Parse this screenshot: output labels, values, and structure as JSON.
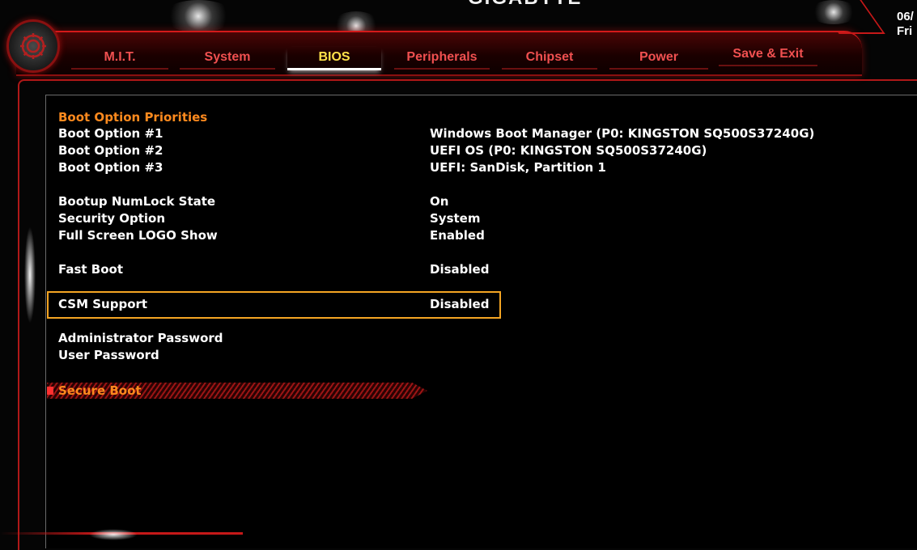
{
  "brand": "GIGABYTE",
  "datetime": {
    "date": "06/",
    "day": "Fri"
  },
  "tabs": [
    {
      "label": "M.I.T."
    },
    {
      "label": "System"
    },
    {
      "label": "BIOS"
    },
    {
      "label": "Peripherals"
    },
    {
      "label": "Chipset"
    },
    {
      "label": "Power"
    },
    {
      "label": "Save & Exit"
    }
  ],
  "active_tab": "BIOS",
  "icons": {
    "settings": "gear-icon"
  },
  "colors": {
    "accent_red": "#c61818",
    "section_header": "#ff8a1e",
    "active_tab": "#ffe24a",
    "highlight_box": "#f5a523",
    "text": "#ffffff"
  },
  "main": {
    "section_header": "Boot Option Priorities",
    "boot_options": [
      {
        "label": "Boot Option #1",
        "value": "Windows Boot Manager (P0: KINGSTON SQ500S37240G)"
      },
      {
        "label": "Boot Option #2",
        "value": "UEFI OS (P0: KINGSTON SQ500S37240G)"
      },
      {
        "label": "Boot Option #3",
        "value": "UEFI: SanDisk, Partition 1"
      }
    ],
    "settings_a": [
      {
        "label": "Bootup NumLock State",
        "value": "On"
      },
      {
        "label": "Security Option",
        "value": "System"
      },
      {
        "label": "Full Screen LOGO Show",
        "value": "Enabled"
      }
    ],
    "fast_boot": {
      "label": "Fast Boot",
      "value": "Disabled"
    },
    "csm_support": {
      "label": "CSM Support",
      "value": "Disabled"
    },
    "passwords": [
      {
        "label": "Administrator Password"
      },
      {
        "label": "User Password"
      }
    ],
    "secure_boot": {
      "label": "Secure Boot"
    }
  }
}
